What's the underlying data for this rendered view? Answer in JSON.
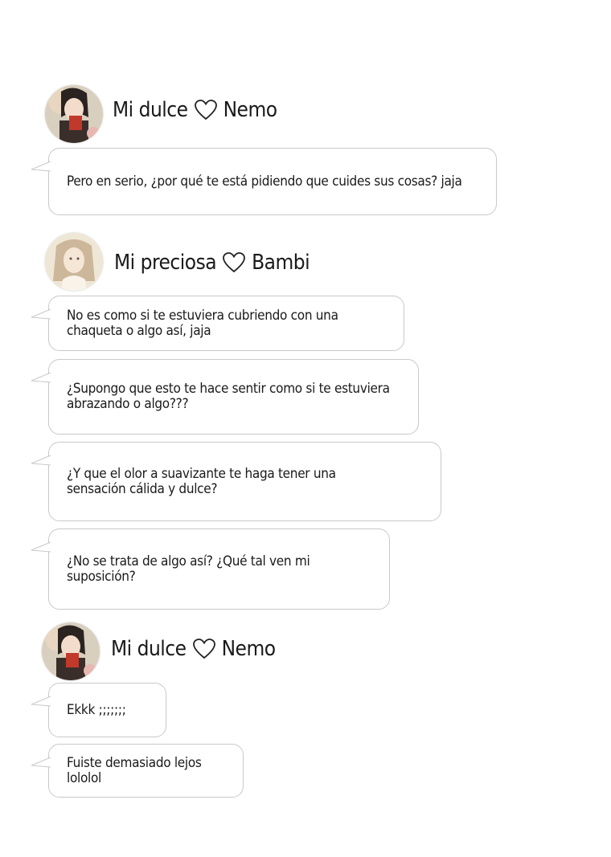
{
  "messages": {
    "group1": {
      "sender": {
        "name_part1": "Mi dulce",
        "name_part2": "Nemo",
        "avatar_icon": "avatar-nemo-icon"
      },
      "bubbles": [
        {
          "text": "Pero en serio, ¿por qué te está pidiendo que cuides sus cosas? jaja"
        }
      ]
    },
    "group2": {
      "sender": {
        "name_part1": "Mi preciosa",
        "name_part2": "Bambi",
        "avatar_icon": "avatar-bambi-icon"
      },
      "bubbles": [
        {
          "text": "No es como si te estuviera cubriendo con una\nchaqueta o algo así, jaja"
        },
        {
          "text": "¿Supongo que esto te hace sentir como si te estuviera\nabrazando o algo???"
        },
        {
          "text": "¿Y que el olor a suavizante te haga tener una\nsensación cálida y dulce?"
        },
        {
          "text": "¿No se trata de algo así? ¿Qué tal ven mi\nsuposición?"
        }
      ]
    },
    "group3": {
      "sender": {
        "name_part1": "Mi dulce",
        "name_part2": "Nemo",
        "avatar_icon": "avatar-nemo-icon"
      },
      "bubbles": [
        {
          "text": "Ekkk ;;;;;;;"
        },
        {
          "text": "Fuiste demasiado lejos lololol"
        }
      ]
    }
  },
  "icons": {
    "heart": "heart-outline-icon"
  },
  "colors": {
    "bubble_border": "#c9c9c9",
    "text": "#1a1a1a",
    "background": "#ffffff"
  }
}
